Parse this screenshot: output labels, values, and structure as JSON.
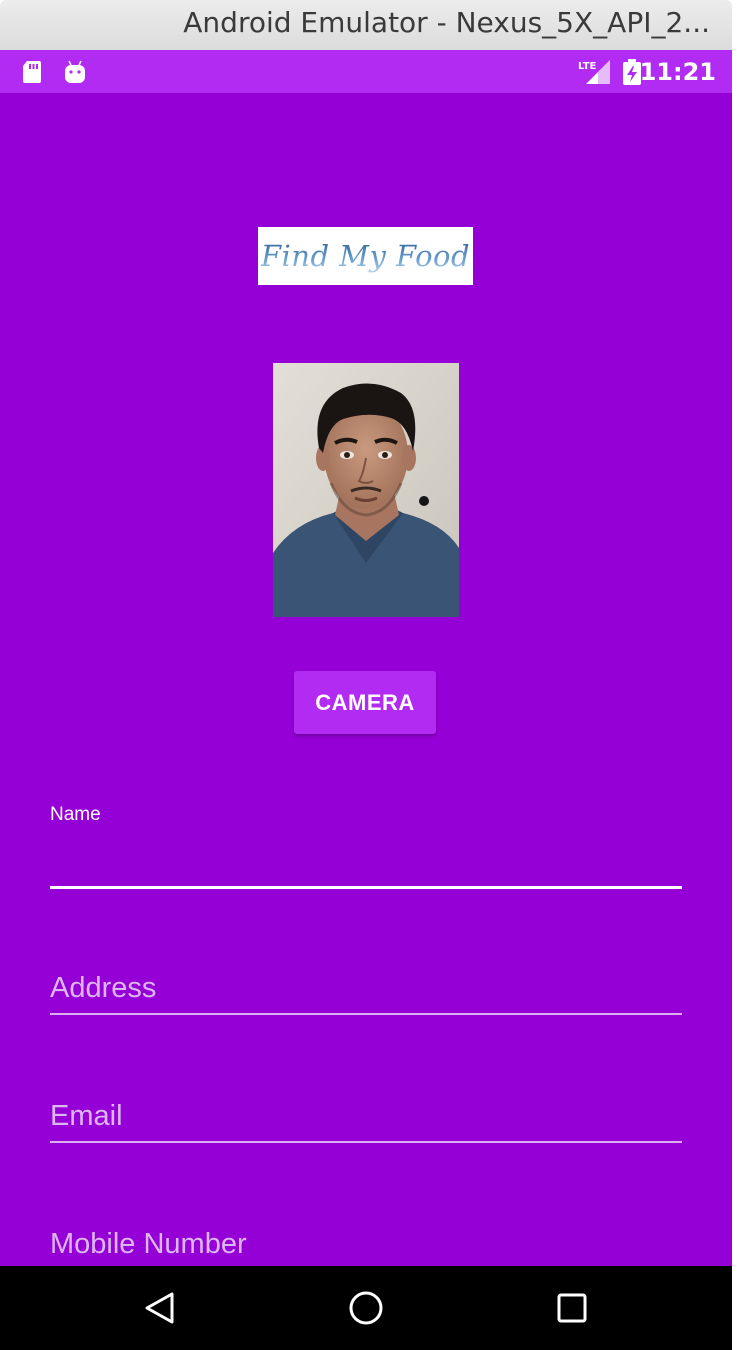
{
  "window": {
    "title": "Android Emulator - Nexus_5X_API_2..."
  },
  "status_bar": {
    "left_icons": [
      "sd-card-icon",
      "android-icon"
    ],
    "right_icons": [
      "lte-signal-icon",
      "battery-charging-icon"
    ],
    "network_label": "LTE",
    "time": "11:21"
  },
  "app": {
    "logo_text": "Find My Food",
    "camera_button": "CAMERA",
    "fields": {
      "name": {
        "label": "Name",
        "value": ""
      },
      "address": {
        "placeholder": "Address"
      },
      "email": {
        "placeholder": "Email"
      },
      "mobile": {
        "placeholder": "Mobile Number"
      }
    }
  },
  "nav_bar": {
    "buttons": [
      "back-icon",
      "home-icon",
      "recents-icon"
    ]
  },
  "colors": {
    "background": "#9400D6",
    "status_bar": "#B22BF2",
    "accent_button": "#B22BF2",
    "hint_text": "#DDB5F0",
    "nav_bar": "#000000"
  }
}
